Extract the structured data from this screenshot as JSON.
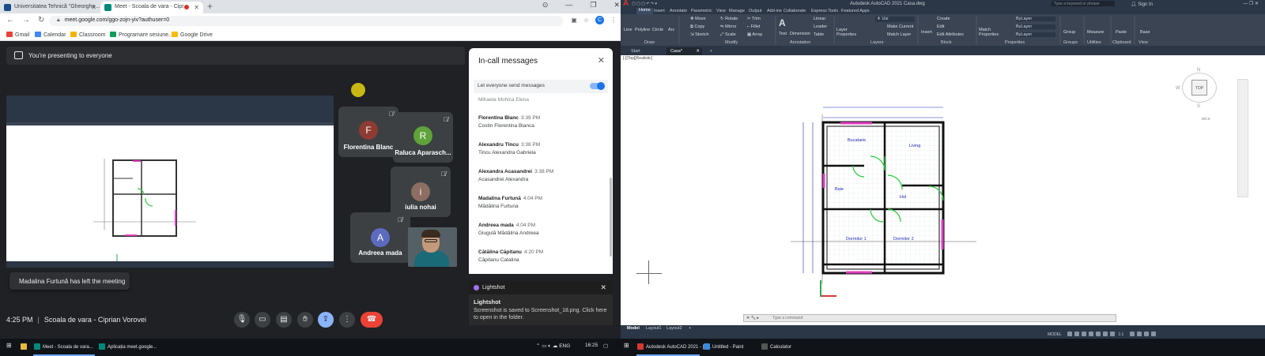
{
  "browser": {
    "tabs": [
      {
        "label": "Universitatea Tehnică \"Gheorghe..."
      },
      {
        "label": "Meet - Scoala de vara - Cipr..."
      }
    ],
    "url": "meet.google.com/ggo-zojn-yiv?authuser=0",
    "profile_initial": "C",
    "bookmarks": [
      "Gmail",
      "Calendar",
      "Classroom",
      "Programare sesiune...",
      "Google Drive"
    ]
  },
  "meet": {
    "presenting_banner": "You're presenting to everyone",
    "participants": [
      {
        "initial": "F",
        "name": "Florentina Blanc",
        "color": "#8d3b33"
      },
      {
        "initial": "R",
        "name": "Raluca Aparasch...",
        "color": "#5fa33a"
      },
      {
        "initial": "i",
        "name": "iulia nohai",
        "color": "#8d6e63"
      },
      {
        "initial": "A",
        "name": "Andreea mada",
        "color": "#5c6bc0"
      }
    ],
    "toast": "Madalina Furtună has left the meeting",
    "time": "4:25 PM",
    "meeting_title": "Scoala de vara - Ciprian Vorovei",
    "chat": {
      "title": "In-call messages",
      "setting_label": "Let everyone send messages",
      "partial_name": "Mihaela Mohica Elena",
      "messages": [
        {
          "sender": "Florentina Blanc",
          "time": "3:39 PM",
          "text": "Costin Florentina Bianca"
        },
        {
          "sender": "Alexandru Tîncu",
          "time": "3:38 PM",
          "text": "Tincu Alexandra Gabriela"
        },
        {
          "sender": "Alexandra Acasandrei",
          "time": "3:38 PM",
          "text": "Acasandrei Alexandra"
        },
        {
          "sender": "Madalina Furtună",
          "time": "4:04 PM",
          "text": "Mădălina Furtuna"
        },
        {
          "sender": "Andreea mada",
          "time": "4:04 PM",
          "text": "Giugulă Mădălina Andreea"
        },
        {
          "sender": "Cătălina Căpitanu",
          "time": "4:20 PM",
          "text": "Căpitanu Catalina"
        }
      ]
    },
    "lightshot": {
      "app": "Lightshot",
      "title": "Lightshot",
      "body": "Screenshot is saved to Screenshot_18.png. Click here to open in the folder."
    }
  },
  "autocad": {
    "title": "Autodesk AutoCAD 2021   Casa.dwg",
    "search_placeholder": "Type a keyword or phrase",
    "sign_in": "Sign In",
    "ribbon_tabs": [
      "Home",
      "Insert",
      "Annotate",
      "Parametric",
      "View",
      "Manage",
      "Output",
      "Add-ins",
      "Collaborate",
      "Express Tools",
      "Featured Apps"
    ],
    "groups": [
      "Draw",
      "Modify",
      "Annotation",
      "Layers",
      "Block",
      "Properties",
      "Groups",
      "Utilities",
      "Clipboard",
      "View"
    ],
    "tools": {
      "line": "Line",
      "polyline": "Polyline",
      "circle": "Circle",
      "arc": "Arc",
      "move": "Move",
      "rotate": "Rotate",
      "trim": "Trim",
      "copy": "Copy",
      "mirror": "Mirror",
      "fillet": "Fillet",
      "stretch": "Stretch",
      "scale": "Scale",
      "array": "Array",
      "text": "Text",
      "dimension": "Dimension",
      "linear": "Linear",
      "leader": "Leader",
      "table": "Table",
      "layer_props": "Layer Properties",
      "make_current": "Make Current",
      "match_layer": "Match Layer",
      "insert": "Insert",
      "create": "Create",
      "edit": "Edit",
      "edit_attributes": "Edit Attributes",
      "match_properties": "Match Properties",
      "bylayer": "ByLayer",
      "group": "Group",
      "measure": "Measure",
      "paste": "Paste",
      "base": "Base",
      "layer_name": "Usi"
    },
    "file_tabs": [
      "Start",
      "Casa*"
    ],
    "viewport_label": "[-][Top][Realistic]",
    "viewcube": {
      "face": "TOP",
      "n": "N",
      "w": "W",
      "s": "S",
      "wcs": "WCS"
    },
    "rooms": [
      "Bucatarie",
      "Living",
      "Baie",
      "Hol",
      "Dormitor 1",
      "Dormitor 2"
    ],
    "command_placeholder": "Type a command",
    "layout_tabs": [
      "Model",
      "Layout1",
      "Layout2"
    ],
    "status_model": "MODEL",
    "scale": "1:1"
  },
  "taskbar": {
    "left_items": [
      "Meet - Scoala de vara...",
      "Aplicația meet.google..."
    ],
    "right_items": [
      "Autodesk AutoCAD 2021 - [C...",
      "Untitled - Paint",
      "Calculator"
    ],
    "clock": "16:25"
  }
}
